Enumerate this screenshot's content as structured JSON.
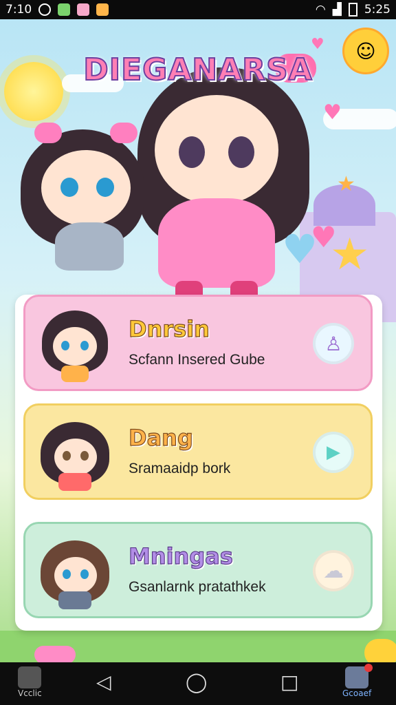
{
  "status": {
    "time_left": "7:10",
    "time_right": "5:25"
  },
  "app": {
    "title": "DIEGANARSA"
  },
  "cards": [
    {
      "name": "Dnrsin",
      "subtitle": "Scfann Insered Gube",
      "icon": "bell-icon",
      "bg": "#f9c6df"
    },
    {
      "name": "Dang",
      "subtitle": "Sramaaidp bork",
      "icon": "play-icon",
      "bg": "#fbe7a0"
    },
    {
      "name": "Mningas",
      "subtitle": "Gsanlarnk pratathkek",
      "icon": "cloud-icon",
      "bg": "#cdeedb"
    }
  ],
  "nav": {
    "left_label": "Vcclic",
    "right_label": "Gcoaef"
  }
}
